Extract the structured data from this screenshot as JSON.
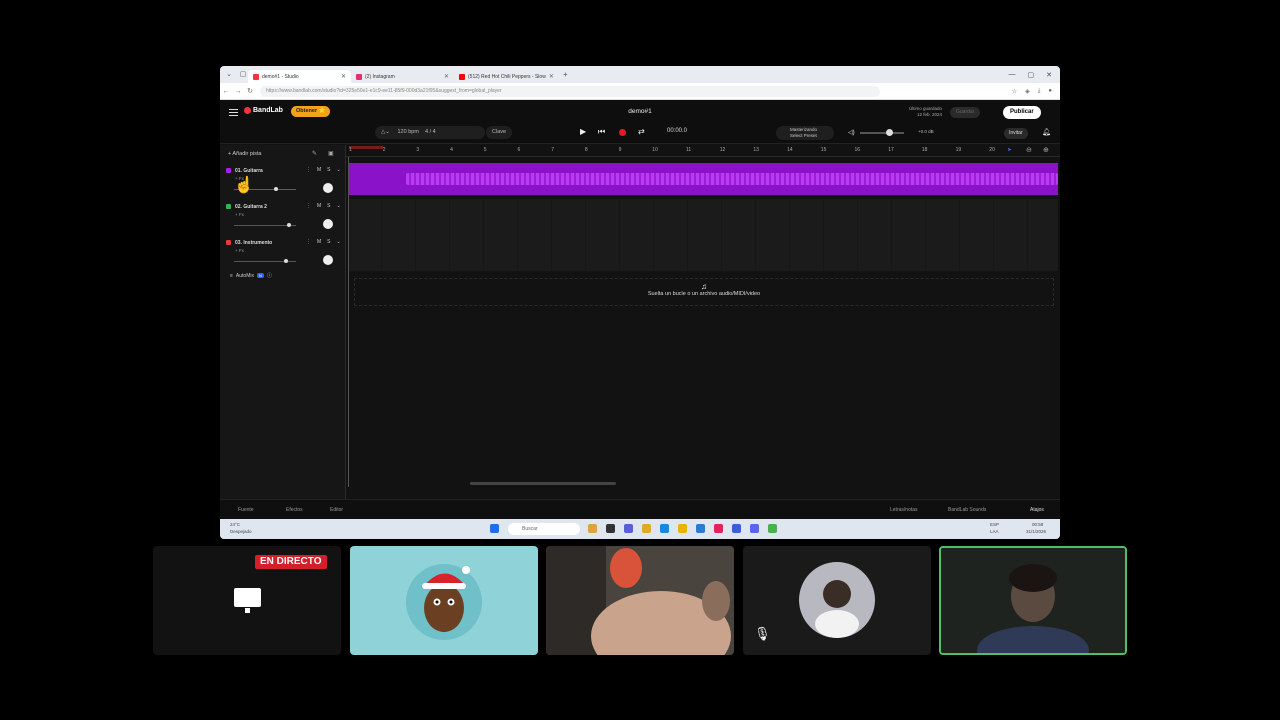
{
  "browser": {
    "tabs": [
      {
        "label": "demo#1 - Studio",
        "color": "#f0353b"
      },
      {
        "label": "(2) Instagram",
        "color": "#e1306c"
      },
      {
        "label": "(512) Red Hot Chili Peppers - Slow",
        "color": "#ff0000"
      }
    ],
    "url": "https://www.bandlab.com/studio?id=325e50e1-e1c9-ee11-85f9-000d3a21f95&suggest_from=global_player"
  },
  "app": {
    "logo": "BandLab",
    "obtener": "Obtener ⭐",
    "project_name": "demo#1",
    "saved_label": "Último guardado",
    "saved_date": "12 feb. 2024",
    "guardar": "Guardar",
    "publicar": "Publicar",
    "bpm": "120",
    "bpm_unit": "bpm",
    "signature": "4 / 4",
    "key": "Clave",
    "time": "00:00.0",
    "mastering_title": "Masterizando",
    "mastering_preset": "Select Preset",
    "db": "+0.0 dB",
    "invitar": "Invitar",
    "add_track": "+ Añadir pista",
    "tracks": [
      {
        "name": "01. Guitarra",
        "fx": "+ Fx",
        "color": "#a020f0"
      },
      {
        "name": "02. Guitarra 2",
        "fx": "+ Fx",
        "color": "#35b24a"
      },
      {
        "name": "03. Instrumento",
        "fx": "+ Fx",
        "color": "#e33b3b"
      }
    ],
    "mute": "M",
    "solo": "S",
    "automix": "AutoMix",
    "automix_badge": "N",
    "bars": [
      "1",
      "2",
      "3",
      "4",
      "5",
      "6",
      "7",
      "8",
      "9",
      "10",
      "11",
      "12",
      "13",
      "14",
      "15",
      "16",
      "17",
      "18",
      "19",
      "20"
    ],
    "drop_hint": "Suelta un bucle o un archivo audio/MIDI/video",
    "bottom": {
      "fuente": "Fuente",
      "efectos": "Efectos",
      "editor": "Editor",
      "letras": "Letras/notas",
      "sounds": "BandLab Sounds",
      "atajos": "Atajos"
    }
  },
  "taskbar": {
    "weather": "24°C",
    "weather_desc": "Despejado",
    "search": "Buscar",
    "lang": "ESP",
    "region": "LAA",
    "clock": "00:58",
    "date": "31/1/2026"
  },
  "call": {
    "live_badge": "EN DIRECTO"
  }
}
